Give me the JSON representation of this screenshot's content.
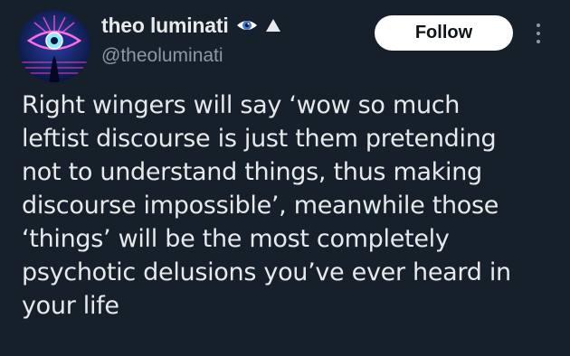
{
  "tweet": {
    "author": {
      "display_name": "theo luminati",
      "handle": "@theoluminati",
      "badges": [
        "eye-emoji-icon",
        "triangle-up-icon"
      ]
    },
    "follow_label": "Follow",
    "more_icon": "more-options-icon",
    "text_lines": [
      "Right wingers will say ‘wow so much",
      "leftist discourse is just them pretending",
      "not to understand things, thus making",
      "discourse impossible’, meanwhile those",
      "‘things’ will be the most completely",
      "psychotic delusions you’ve ever heard in",
      "your life"
    ]
  },
  "colors": {
    "background": "#15202b",
    "text_primary": "#e7e9ea",
    "text_secondary": "#8b98a5",
    "button_bg": "#ffffff",
    "button_text": "#0f1419"
  }
}
